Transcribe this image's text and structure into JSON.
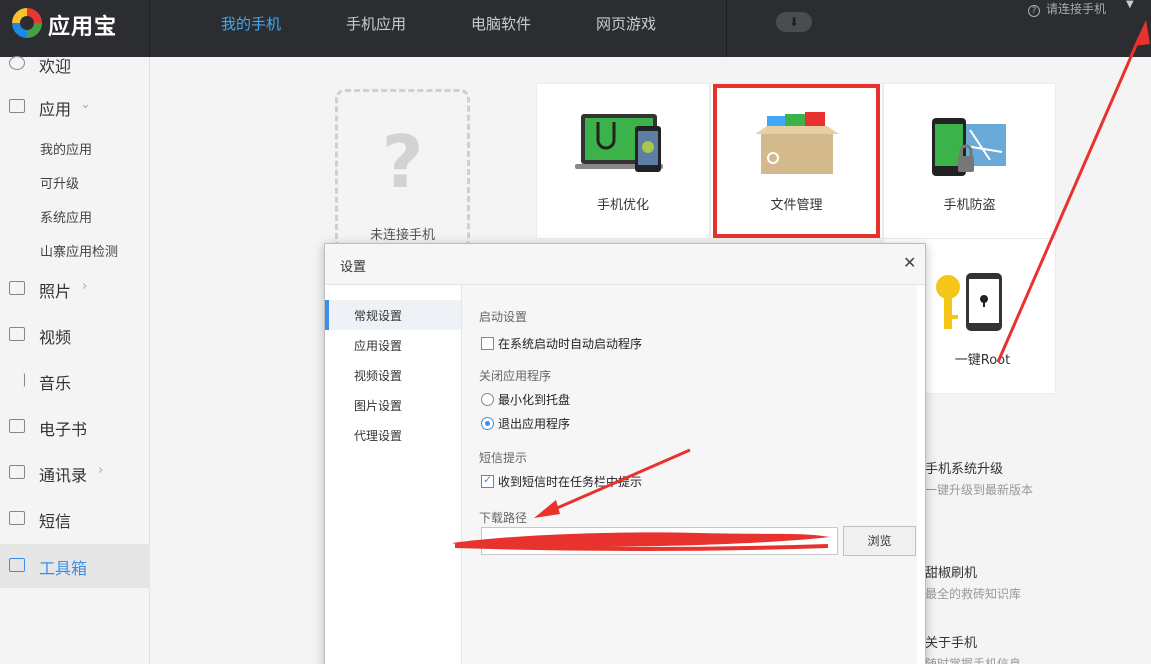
{
  "app": {
    "name": "应用宝"
  },
  "topnav": {
    "tabs": [
      "我的手机",
      "手机应用",
      "电脑软件",
      "网页游戏"
    ],
    "connect_text": "请连接手机"
  },
  "sidebar": {
    "welcome": "欢迎",
    "apps": "应用",
    "app_subitems": [
      "我的应用",
      "可升级",
      "系统应用",
      "山寨应用检测"
    ],
    "photos": "照片",
    "video": "视频",
    "music": "音乐",
    "ebook": "电子书",
    "contacts": "通讯录",
    "sms": "短信",
    "toolbox": "工具箱"
  },
  "main": {
    "unknown_label": "未连接手机",
    "tiles": [
      "手机优化",
      "文件管理",
      "手机防盗",
      "一键Root"
    ],
    "right_list": [
      {
        "title": "手机系统升级",
        "desc": "一键升级到最新版本"
      },
      {
        "title": "甜椒刷机",
        "desc": "最全的救砖知识库"
      },
      {
        "title": "关于手机",
        "desc": "随时掌握手机信息"
      }
    ]
  },
  "dialog": {
    "title": "设置",
    "nav": [
      "常规设置",
      "应用设置",
      "视频设置",
      "图片设置",
      "代理设置"
    ],
    "startup_title": "启动设置",
    "startup_option": "在系统启动时自动启动程序",
    "close_title": "关闭应用程序",
    "close_minimize": "最小化到托盘",
    "close_exit": "退出应用程序",
    "sms_title": "短信提示",
    "sms_option": "收到短信时在任务栏中提示",
    "download_title": "下载路径",
    "download_path": "",
    "browse_label": "浏览"
  },
  "colors": {
    "accent": "#3d8fe6",
    "annotation": "#e8322d",
    "topbar": "#2b2d30"
  }
}
